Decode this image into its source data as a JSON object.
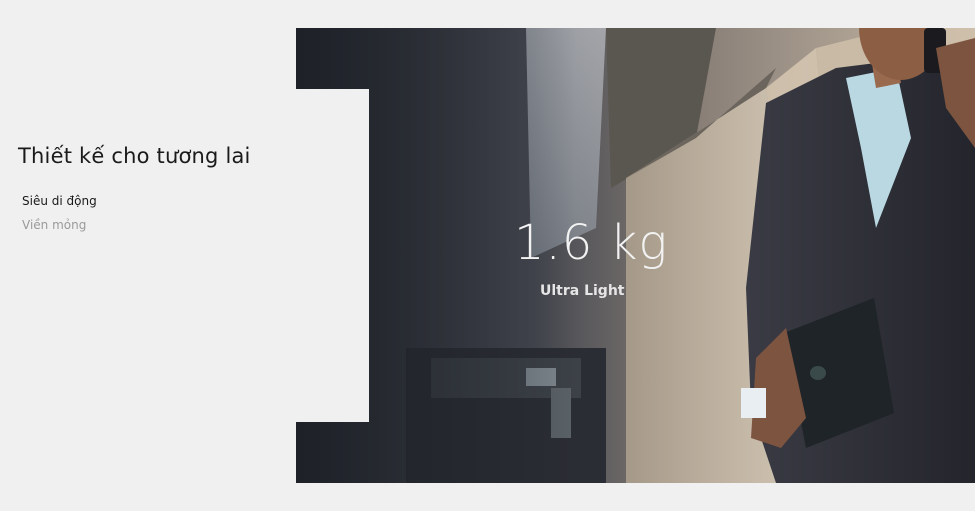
{
  "section": {
    "title": "Thiết kế cho tương lai",
    "features": [
      {
        "label": "Siêu di động",
        "active": true
      },
      {
        "label": "Viền mỏng",
        "active": false
      }
    ]
  },
  "hero": {
    "weight": "1.6 kg",
    "weight_caption": "Ultra Light"
  }
}
